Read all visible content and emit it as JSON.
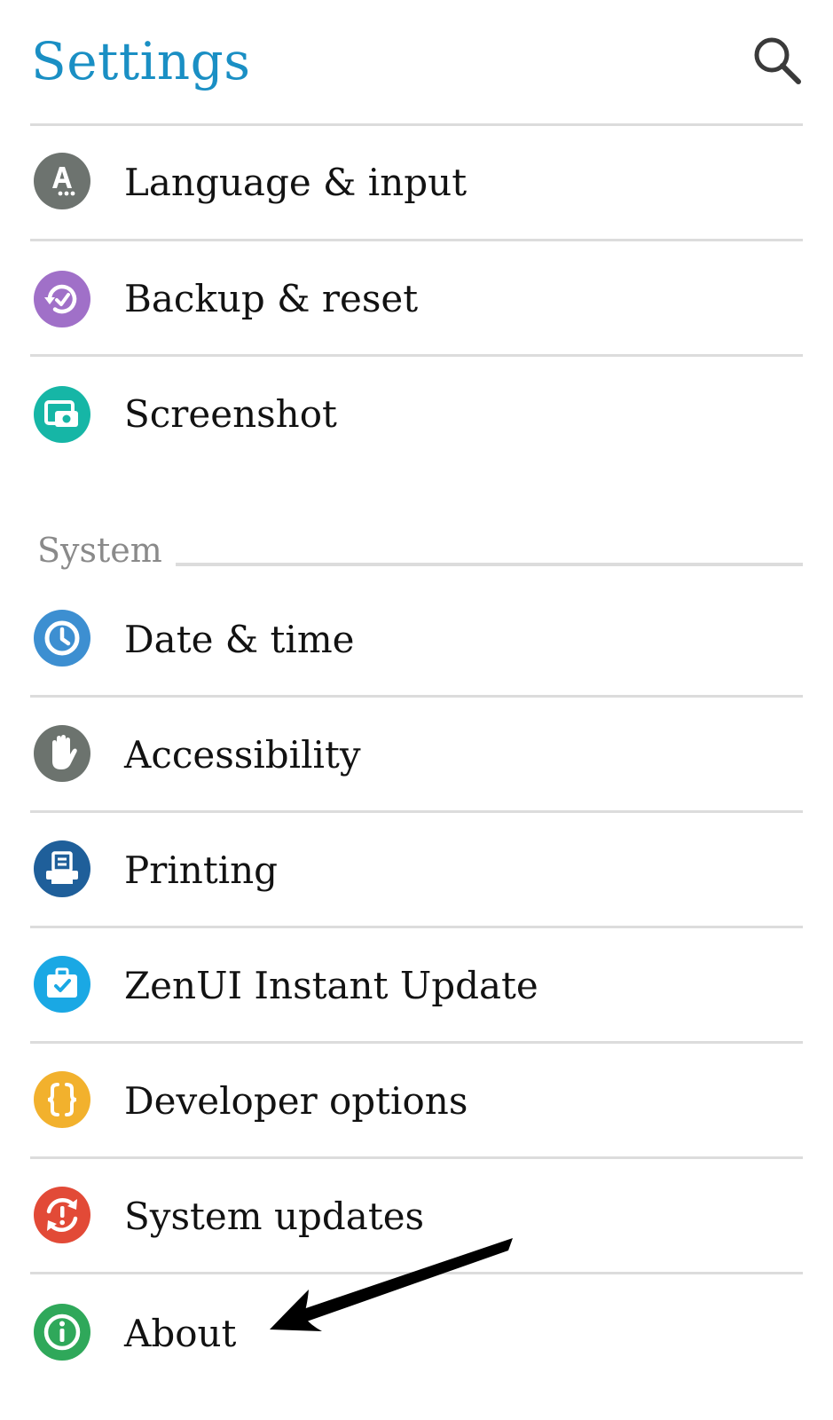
{
  "header": {
    "title": "Settings",
    "search_icon": "search-icon"
  },
  "personal_items": [
    {
      "label": "Language & input",
      "icon": "language-icon",
      "color": "#6d736f"
    },
    {
      "label": "Backup & reset",
      "icon": "backup-icon",
      "color": "#a070c8"
    },
    {
      "label": "Screenshot",
      "icon": "screenshot-icon",
      "color": "#16b6a6"
    }
  ],
  "system_section": {
    "title": "System",
    "items": [
      {
        "label": "Date & time",
        "icon": "clock-icon",
        "color": "#3d8fd1"
      },
      {
        "label": "Accessibility",
        "icon": "hand-icon",
        "color": "#6c736e"
      },
      {
        "label": "Printing",
        "icon": "printer-icon",
        "color": "#1f5f9a"
      },
      {
        "label": "ZenUI Instant Update",
        "icon": "briefcase-check-icon",
        "color": "#1aa8e4"
      },
      {
        "label": "Developer options",
        "icon": "braces-icon",
        "color": "#f2b12d"
      },
      {
        "label": "System updates",
        "icon": "system-update-icon",
        "color": "#e24a37"
      },
      {
        "label": "About",
        "icon": "info-icon",
        "color": "#2fa85a"
      }
    ]
  },
  "annotation": {
    "arrow_icon": "pointer-arrow-icon",
    "arrow_color": "#000000"
  }
}
